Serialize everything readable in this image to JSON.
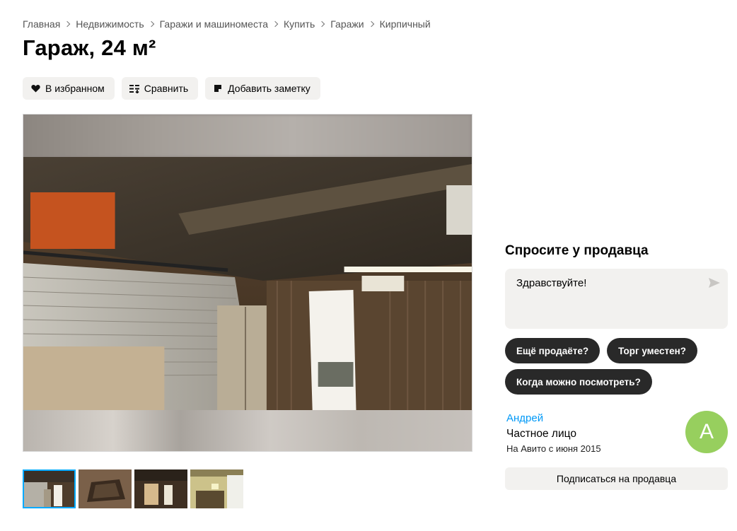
{
  "breadcrumbs": [
    "Главная",
    "Недвижимость",
    "Гаражи и машиноместа",
    "Купить",
    "Гаражи",
    "Кирпичный"
  ],
  "title": "Гараж, 24 м²",
  "actions": {
    "favorite": "В избранном",
    "compare": "Сравнить",
    "note": "Добавить заметку"
  },
  "gallery": {
    "thumbnail_count": 4,
    "active_thumbnail": 1
  },
  "ask_seller": {
    "title": "Спросите у продавца",
    "message_value": "Здравствуйте!",
    "quick_replies": [
      "Ещё продаёте?",
      "Торг уместен?",
      "Когда можно посмотреть?"
    ]
  },
  "seller": {
    "name": "Андрей",
    "type": "Частное лицо",
    "since": "На Авито с июня 2015",
    "avatar_letter": "А",
    "avatar_color": "#97cf5e"
  },
  "subscribe_label": "Подписаться на продавца",
  "colors": {
    "link": "#0099f7",
    "chip_bg": "#292929",
    "button_bg": "#f2f1ef",
    "active_thumb_outline": "#00aaff"
  },
  "icons": [
    "heart-icon",
    "compare-icon",
    "note-icon",
    "send-icon"
  ]
}
